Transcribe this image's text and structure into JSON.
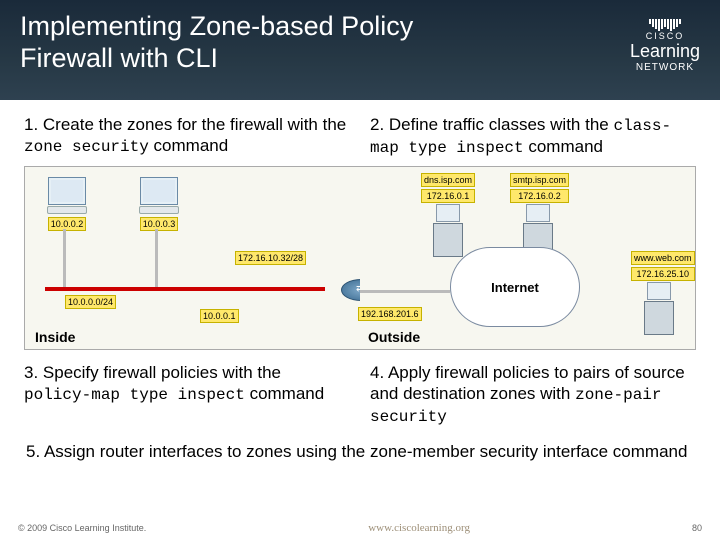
{
  "header": {
    "title": "Implementing Zone-based Policy Firewall with CLI",
    "logo": {
      "brand": "CISCO",
      "line1": "Learning",
      "line2": "NETWORK"
    }
  },
  "steps": {
    "s1": {
      "n": "1. ",
      "text_a": "Create the zones for the firewall with the ",
      "cmd": "zone security",
      "text_b": " command"
    },
    "s2": {
      "n": "2. ",
      "text_a": "Define traffic classes with the ",
      "cmd": "class-map type inspect",
      "text_b": " command"
    },
    "s3": {
      "n": "3. ",
      "text_a": "Specify firewall policies with the ",
      "cmd": "policy-map type inspect",
      "text_b": " command"
    },
    "s4": {
      "n": "4. ",
      "text_a": "Apply firewall policies to pairs of source and destination zones with ",
      "cmd": "zone-pair security",
      "text_b": ""
    },
    "s5": {
      "n": "5. ",
      "text_a": "Assign router interfaces to zones using the ",
      "cmd": "zone-member security",
      "text_b": " interface command"
    }
  },
  "diagram": {
    "inside_label": "Inside",
    "outside_label": "Outside",
    "pc1_ip": "10.0.0.2",
    "pc2_ip": "10.0.0.3",
    "subnet_mid": "172.16.10.32/28",
    "subnet_lan": "10.0.0.0/24",
    "router_inside_ip": "10.0.0.1",
    "router_outside_ip": "192.168.201.6",
    "dns": {
      "host": "dns.isp.com",
      "ip": "172.16.0.1"
    },
    "smtp": {
      "host": "smtp.isp.com",
      "ip": "172.16.0.2"
    },
    "web": {
      "host": "www.web.com",
      "ip": "172.16.25.10"
    },
    "cloud": "Internet"
  },
  "footer": {
    "copyright": "© 2009 Cisco Learning Institute.",
    "url": "www.ciscolearning.org",
    "page": "80"
  }
}
